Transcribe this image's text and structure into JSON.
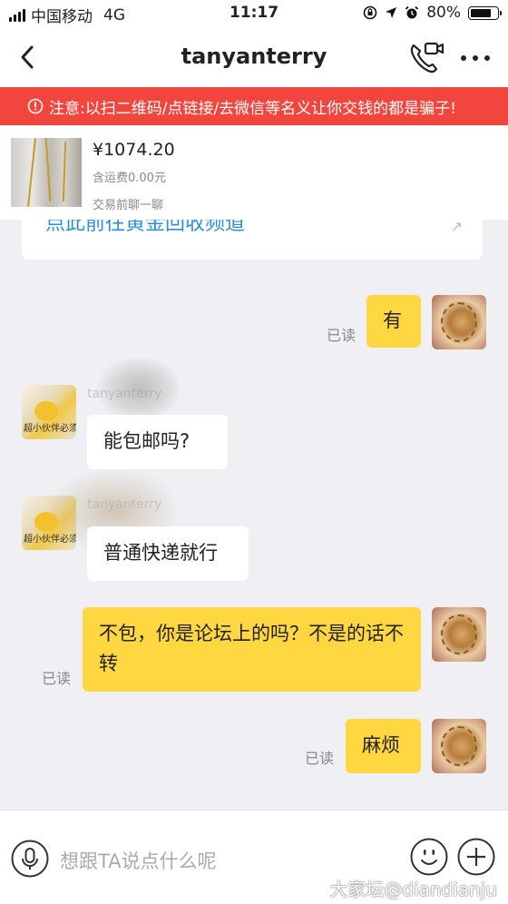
{
  "status_bar": {
    "carrier": "中国移动",
    "network": "4G",
    "time": "11:17",
    "battery": "80%",
    "battery_level": 0.8
  },
  "header": {
    "title": "tanyanterry"
  },
  "warning": {
    "text": "注意:以扫二维码/点链接/去微信等名义让你交钱的都是骗子!"
  },
  "product": {
    "price": "¥1074.20",
    "shipping": "含运费0.00元",
    "note": "交易前聊一聊"
  },
  "previous_card": {
    "link_text": "点此前往黄金回收频道"
  },
  "messages": [
    {
      "sender": "me",
      "text": "有",
      "status": "已读"
    },
    {
      "sender": "other",
      "nickname": "tanyanterry",
      "text": "能包邮吗?"
    },
    {
      "sender": "other",
      "nickname": "tanyanterry",
      "text": "普通快递就行"
    },
    {
      "sender": "me",
      "text": "不包，你是论坛上的吗？不是的话不转",
      "status": "已读"
    },
    {
      "sender": "me",
      "text": "麻烦",
      "status": "已读"
    }
  ],
  "avatar_other": {
    "caption": "超小伙伴必须"
  },
  "input": {
    "placeholder": "想跟TA说点什么呢"
  },
  "watermark": "大家坛@diandianju",
  "colors": {
    "warning_bg": "#f2453d",
    "my_bubble": "#ffd740",
    "link": "#2b8fe0"
  }
}
